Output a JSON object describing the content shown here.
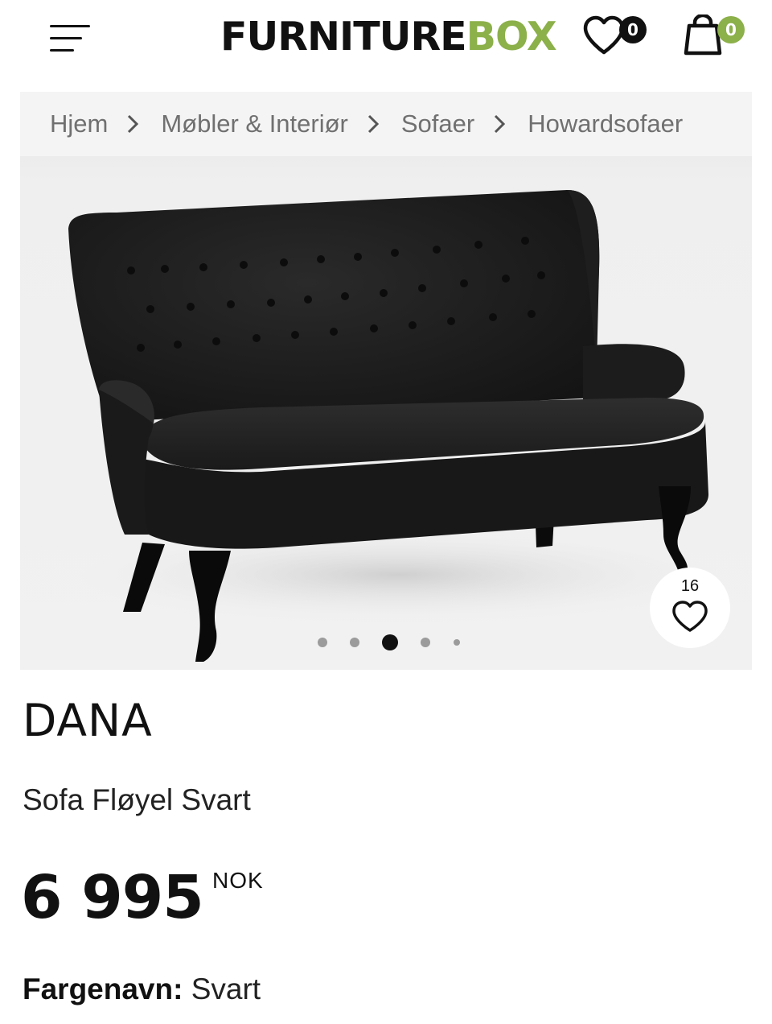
{
  "header": {
    "logo_part1": "FURNITURE",
    "logo_part2": "BOX",
    "wishlist_count": "0",
    "cart_count": "0",
    "brand_color": "#8cb04a",
    "icons": [
      "menu-icon",
      "heart-icon",
      "shopping-bag-icon"
    ]
  },
  "breadcrumb": [
    "Hjem",
    "Møbler & Interiør",
    "Sofaer",
    "Howardsofaer"
  ],
  "gallery": {
    "favorite_count": "16",
    "slide_count": 5,
    "active_slide": 3
  },
  "product": {
    "name": "DANA",
    "subtitle": "Sofa Fløyel Svart",
    "price": "6 995",
    "currency": "NOK",
    "color_label": "Fargenavn:",
    "color_value": "Svart"
  }
}
